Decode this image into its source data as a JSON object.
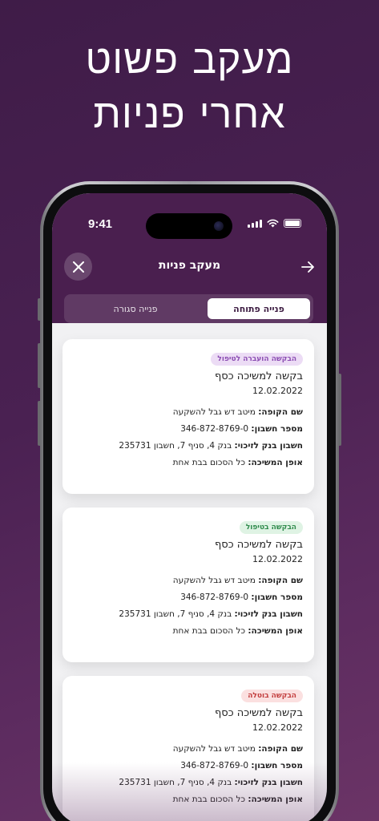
{
  "headline": {
    "line1": "מעקב פשוט",
    "line2": "אחרי פניות"
  },
  "status_bar": {
    "time": "9:41"
  },
  "nav": {
    "title": "מעקב פניות",
    "close_icon": "close-icon",
    "back_icon": "arrow-right-icon"
  },
  "tabs": {
    "open": "פנייה פתוחה",
    "closed": "פנייה סגורה",
    "selected": "open"
  },
  "cards": [
    {
      "status": "הבקשה הועברה לטיפול",
      "status_color": "#8a4bb2",
      "title": "בקשה למשיכה כסף",
      "date": "12.02.2022",
      "fund_label": "שם הקופה:",
      "fund_value": "מיטב דש גבל להשקעה",
      "account_label": "מספר חשבון:",
      "account_value": "346-872-8769-0",
      "bank_label": "חשבון בנק לזיכוי:",
      "bank_value": "בנק 4, סניף 7, חשבון 235731",
      "method_label": "אופן המשיכה:",
      "method_value": "כל הסכום בבת אחת"
    },
    {
      "status": "הבקשה בטיפול",
      "status_color": "#2e8a4b",
      "title": "בקשה למשיכה כסף",
      "date": "12.02.2022",
      "fund_label": "שם הקופה:",
      "fund_value": "מיטב דש גבל להשקעה",
      "account_label": "מספר חשבון:",
      "account_value": "346-872-8769-0",
      "bank_label": "חשבון בנק לזיכוי:",
      "bank_value": "בנק 4, סניף 7, חשבון 235731",
      "method_label": "אופן המשיכה:",
      "method_value": "כל הסכום בבת אחת"
    },
    {
      "status": "הבקשה בוטלה",
      "status_color": "#c23b3b",
      "title": "בקשה למשיכה כסף",
      "date": "12.02.2022",
      "fund_label": "שם הקופה:",
      "fund_value": "מיטב דש גבל להשקעה",
      "account_label": "מספר חשבון:",
      "account_value": "346-872-8769-0",
      "bank_label": "חשבון בנק לזיכוי:",
      "bank_value": "בנק 4, סניף 7, חשבון 235731",
      "method_label": "אופן המשיכה:",
      "method_value": "כל הסכום בבת אחת"
    }
  ]
}
